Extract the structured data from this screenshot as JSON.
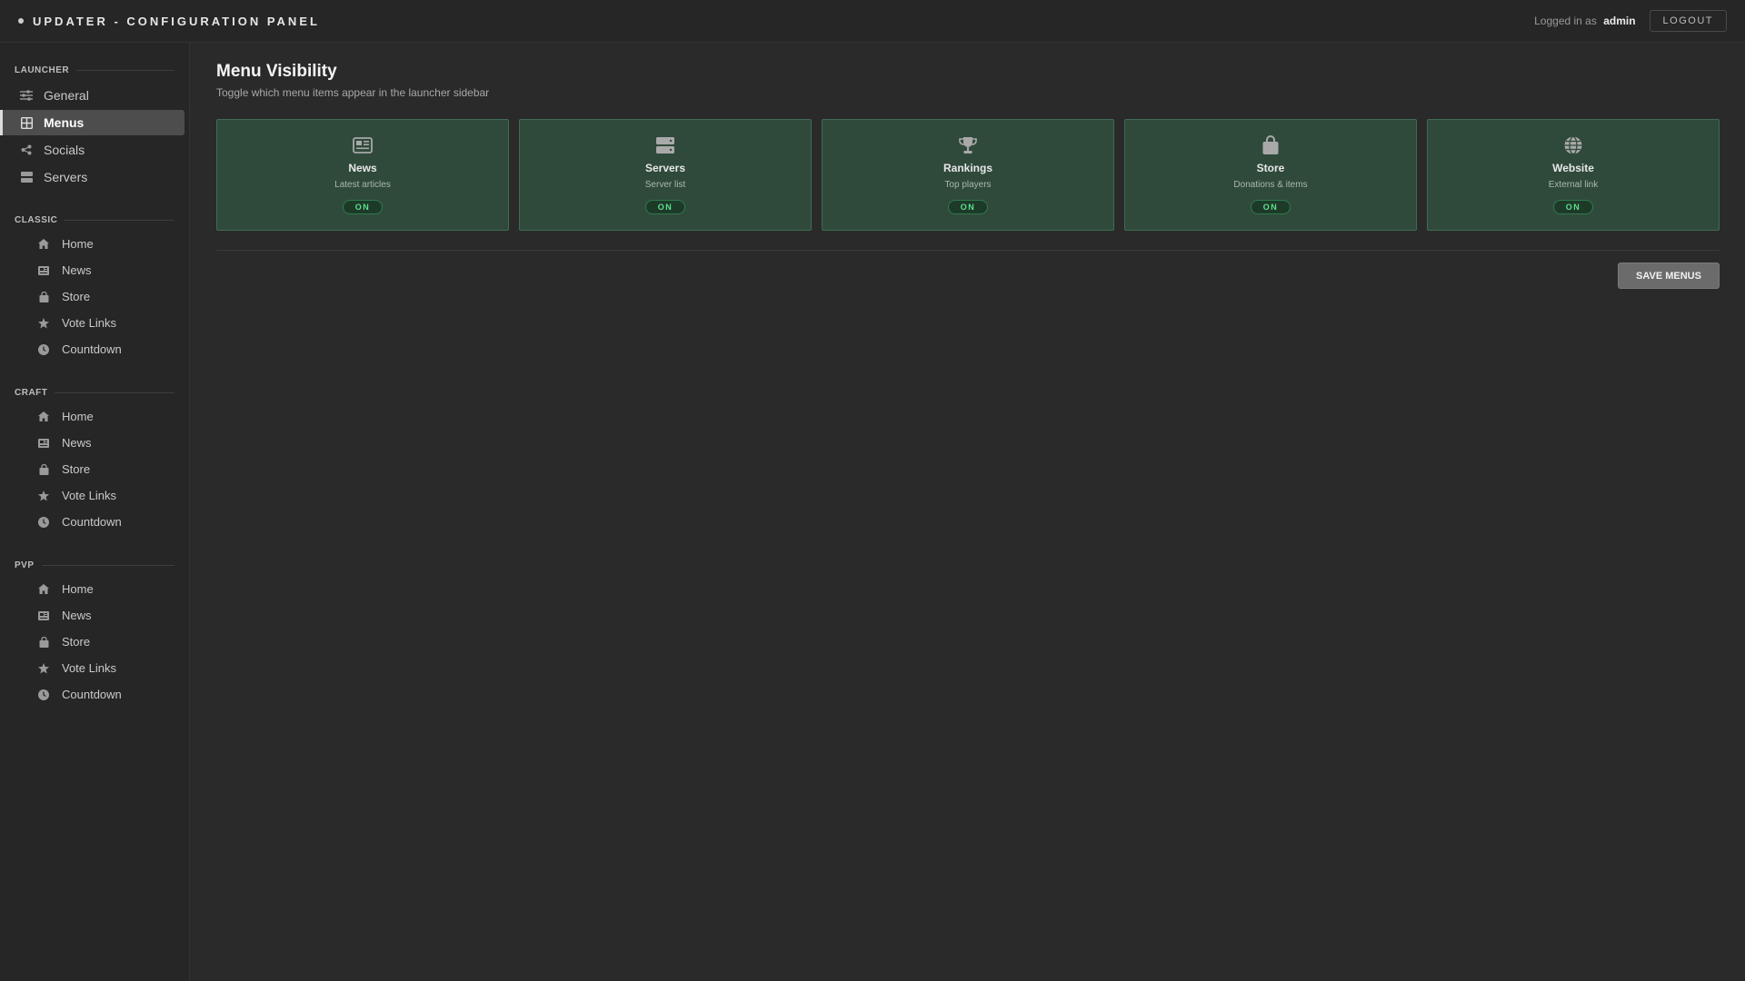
{
  "header": {
    "title": "UPDATER - CONFIGURATION PANEL",
    "logged_in_prefix": "Logged in as",
    "username": "admin",
    "logout_label": "LOGOUT"
  },
  "sidebar": {
    "launcher": {
      "title": "LAUNCHER",
      "items": [
        {
          "label": "General",
          "icon": "sliders-icon"
        },
        {
          "label": "Menus",
          "icon": "grid-icon",
          "active": true
        },
        {
          "label": "Socials",
          "icon": "share-icon"
        },
        {
          "label": "Servers",
          "icon": "server-icon"
        }
      ]
    },
    "classic": {
      "title": "CLASSIC",
      "items": [
        {
          "label": "Home",
          "icon": "home-icon"
        },
        {
          "label": "News",
          "icon": "newspaper-icon"
        },
        {
          "label": "Store",
          "icon": "bag-icon"
        },
        {
          "label": "Vote Links",
          "icon": "star-icon"
        },
        {
          "label": "Countdown",
          "icon": "clock-icon"
        }
      ]
    },
    "craft": {
      "title": "CRAFT",
      "items": [
        {
          "label": "Home",
          "icon": "home-icon"
        },
        {
          "label": "News",
          "icon": "newspaper-icon"
        },
        {
          "label": "Store",
          "icon": "bag-icon"
        },
        {
          "label": "Vote Links",
          "icon": "star-icon"
        },
        {
          "label": "Countdown",
          "icon": "clock-icon"
        }
      ]
    },
    "pvp": {
      "title": "PVP",
      "items": [
        {
          "label": "Home",
          "icon": "home-icon"
        },
        {
          "label": "News",
          "icon": "newspaper-icon"
        },
        {
          "label": "Store",
          "icon": "bag-icon"
        },
        {
          "label": "Vote Links",
          "icon": "star-icon"
        },
        {
          "label": "Countdown",
          "icon": "clock-icon"
        }
      ]
    }
  },
  "main": {
    "title": "Menu Visibility",
    "subtitle": "Toggle which menu items appear in the launcher sidebar",
    "cards": [
      {
        "title": "News",
        "desc": "Latest articles",
        "status": "ON",
        "icon": "newspaper-icon"
      },
      {
        "title": "Servers",
        "desc": "Server list",
        "status": "ON",
        "icon": "server-icon"
      },
      {
        "title": "Rankings",
        "desc": "Top players",
        "status": "ON",
        "icon": "trophy-icon"
      },
      {
        "title": "Store",
        "desc": "Donations & items",
        "status": "ON",
        "icon": "bag-icon"
      },
      {
        "title": "Website",
        "desc": "External link",
        "status": "ON",
        "icon": "globe-icon"
      }
    ],
    "save_label": "SAVE MENUS"
  },
  "colors": {
    "background": "#2a2a2a",
    "card_bg": "#2f4a3b",
    "toggle_on": "#5fe08f",
    "active_item": "#4d4d4d"
  }
}
